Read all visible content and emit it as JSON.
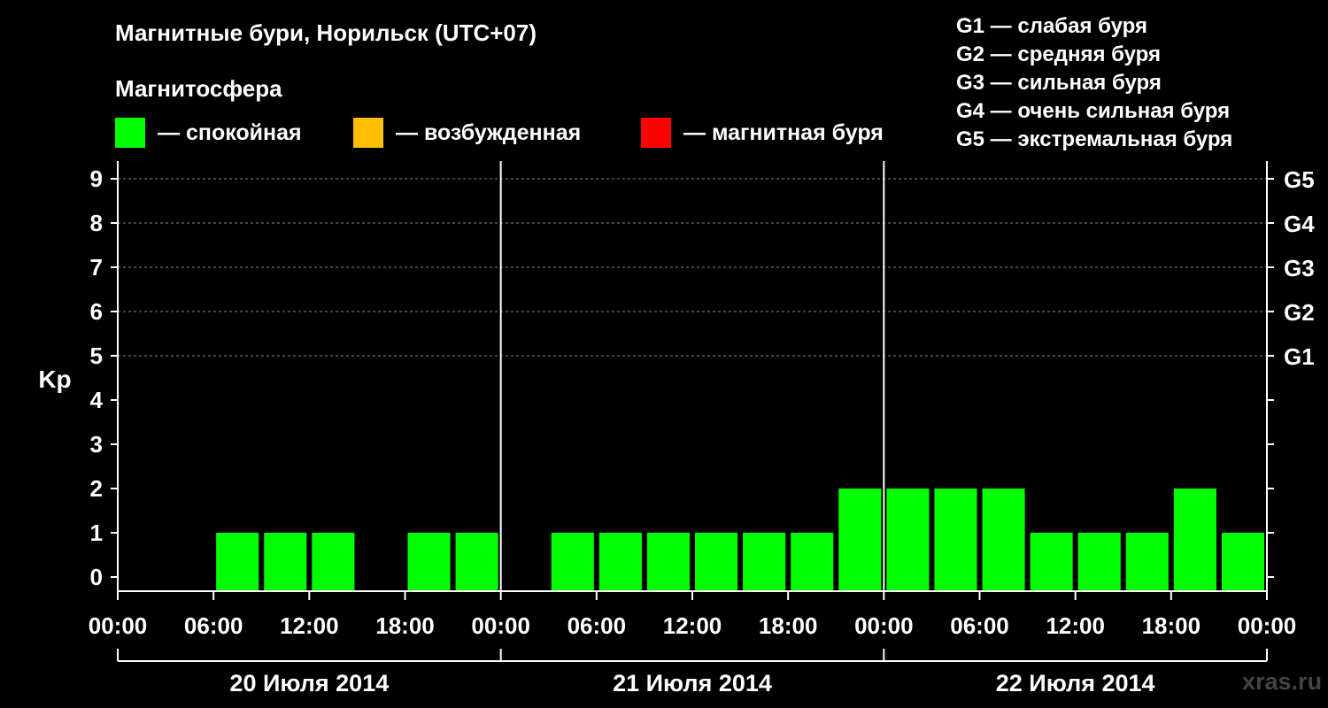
{
  "title": "Магнитные бури, Норильск (UTC+07)",
  "subtitle": "Магнитосфера",
  "colors": {
    "quiet": "#00ff00",
    "excited": "#ffbf00",
    "storm": "#ff0000",
    "background": "#000000",
    "watermark": "#444444"
  },
  "legend": [
    {
      "label": "— спокойная",
      "color": "#00ff00"
    },
    {
      "label": "— возбужденная",
      "color": "#ffbf00"
    },
    {
      "label": "— магнитная буря",
      "color": "#ff0000"
    }
  ],
  "storm_levels": [
    "G1 — слабая буря",
    "G2 — средняя буря",
    "G3 — сильная буря",
    "G4 — очень сильная буря",
    "G5 — экстремальная буря"
  ],
  "watermark": "xras.ru",
  "chart_data": {
    "type": "bar",
    "ylabel": "Kp",
    "ylim": [
      0,
      9
    ],
    "yticks": [
      0,
      1,
      2,
      3,
      4,
      5,
      6,
      7,
      8,
      9
    ],
    "right_ticks": [
      {
        "value": 5,
        "label": "G1"
      },
      {
        "value": 6,
        "label": "G2"
      },
      {
        "value": 7,
        "label": "G3"
      },
      {
        "value": 8,
        "label": "G4"
      },
      {
        "value": 9,
        "label": "G5"
      }
    ],
    "grid": true,
    "xtick_labels": [
      "00:00",
      "06:00",
      "12:00",
      "18:00",
      "00:00",
      "06:00",
      "12:00",
      "18:00",
      "00:00",
      "06:00",
      "12:00",
      "18:00",
      "00:00"
    ],
    "days": [
      "20 Июля 2014",
      "21 Июля 2014",
      "22 Июля 2014"
    ],
    "interval_hours": 3,
    "values": [
      0,
      0,
      1,
      1,
      1,
      0,
      1,
      1,
      0,
      1,
      1,
      1,
      1,
      1,
      1,
      2,
      2,
      2,
      2,
      1,
      1,
      1,
      2,
      1
    ]
  }
}
